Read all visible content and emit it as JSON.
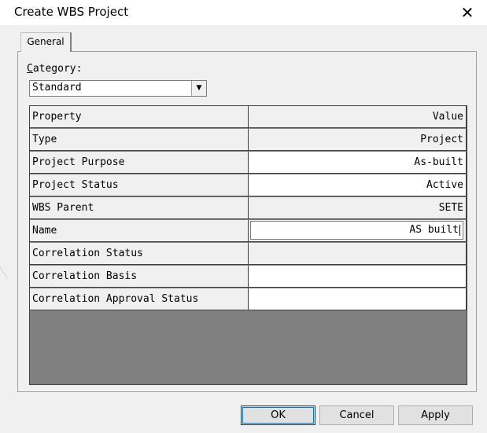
{
  "window": {
    "title": "Create WBS Project",
    "close_glyph": "✕"
  },
  "tabs": [
    {
      "label": "General"
    }
  ],
  "category": {
    "label_accel": "C",
    "label_rest": "ategory:",
    "value": "Standard",
    "dropdown_glyph": "▼"
  },
  "grid": {
    "header": {
      "property": "Property",
      "value": "Value"
    },
    "rows": [
      {
        "property": "Type",
        "value": "Project"
      },
      {
        "property": "Project Purpose",
        "value": "As-built"
      },
      {
        "property": "Project Status",
        "value": "Active"
      },
      {
        "property": "WBS Parent",
        "value": "SETE"
      },
      {
        "property": "Name",
        "value": "AS built"
      },
      {
        "property": "Correlation Status",
        "value": ""
      },
      {
        "property": "Correlation Basis",
        "value": ""
      },
      {
        "property": "Correlation Approval Status",
        "value": ""
      }
    ]
  },
  "buttons": {
    "ok": "OK",
    "cancel": "Cancel",
    "apply": "Apply"
  }
}
